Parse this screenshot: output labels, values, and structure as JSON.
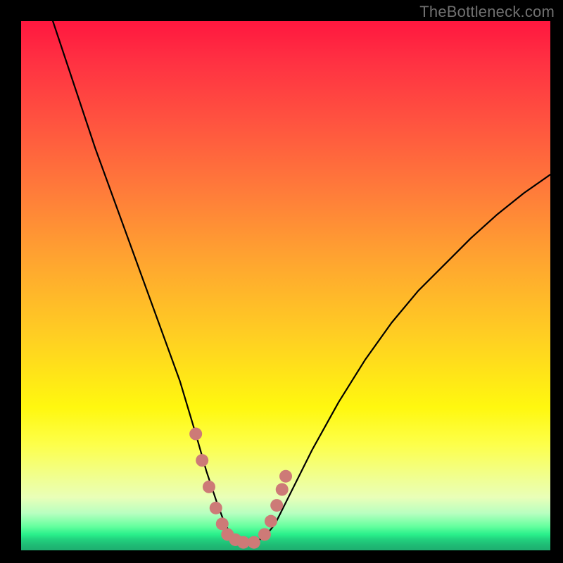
{
  "watermark": "TheBottleneck.com",
  "chart_data": {
    "type": "line",
    "title": "",
    "xlabel": "",
    "ylabel": "",
    "x_range": [
      0,
      100
    ],
    "y_range": [
      0,
      100
    ],
    "series": [
      {
        "name": "curve",
        "x": [
          6,
          10,
          14,
          18,
          22,
          26,
          30,
          33,
          35,
          37,
          38.5,
          40,
          41,
          42,
          44,
          46,
          48,
          50,
          55,
          60,
          65,
          70,
          75,
          80,
          85,
          90,
          95,
          100
        ],
        "y": [
          100,
          88,
          76,
          65,
          54,
          43,
          32,
          22,
          15,
          9,
          5,
          2.5,
          1.5,
          1.5,
          1.5,
          2.5,
          5,
          9,
          19,
          28,
          36,
          43,
          49,
          54,
          59,
          63.5,
          67.5,
          71
        ]
      }
    ],
    "markers": {
      "name": "optimum-band",
      "color": "#cd7a77",
      "points": [
        {
          "x": 33.0,
          "y": 22
        },
        {
          "x": 34.2,
          "y": 17
        },
        {
          "x": 35.5,
          "y": 12
        },
        {
          "x": 36.8,
          "y": 8
        },
        {
          "x": 38.0,
          "y": 5
        },
        {
          "x": 39.0,
          "y": 3
        },
        {
          "x": 40.5,
          "y": 2
        },
        {
          "x": 42.0,
          "y": 1.5
        },
        {
          "x": 44.0,
          "y": 1.5
        },
        {
          "x": 46.0,
          "y": 3
        },
        {
          "x": 47.2,
          "y": 5.5
        },
        {
          "x": 48.3,
          "y": 8.5
        },
        {
          "x": 49.3,
          "y": 11.5
        },
        {
          "x": 50.0,
          "y": 14
        }
      ]
    },
    "gradient_stops": [
      {
        "pos": 0.0,
        "color": "#ff173f"
      },
      {
        "pos": 0.3,
        "color": "#ff7b3a"
      },
      {
        "pos": 0.6,
        "color": "#ffd022"
      },
      {
        "pos": 0.8,
        "color": "#fdff4a"
      },
      {
        "pos": 0.95,
        "color": "#64ff9e"
      },
      {
        "pos": 1.0,
        "color": "#1ead6f"
      }
    ]
  }
}
